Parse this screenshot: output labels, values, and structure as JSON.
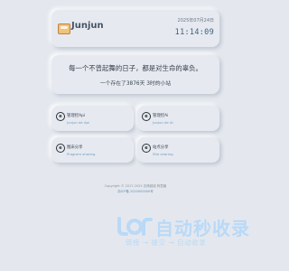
{
  "header": {
    "site_name": "Junjun",
    "date": "2025年07月24日",
    "time": "11:14:09"
  },
  "quote": {
    "motto": "每一个不曾起舞的日子，都是对生命的辜负。",
    "since": "一个存在了3876天 3时的小站"
  },
  "cards": [
    {
      "title": "管理控Api",
      "subtitle": "Junjun de Api",
      "icon": "circle-e-icon"
    },
    {
      "title": "管理控Ai",
      "subtitle": "Junjun de Ai",
      "icon": "circle-e-icon"
    },
    {
      "title": "图床分享",
      "subtitle": "Program sharing",
      "icon": "circle-e-icon"
    },
    {
      "title": "站点分享",
      "subtitle": "Site sharing",
      "icon": "circle-e-icon"
    }
  ],
  "footer": {
    "copyright": "Copyright © 2017-2025 友情链接 阿里酱",
    "beian": "浙ICP备 2020000000号"
  },
  "watermark": {
    "title": "自动秒收录",
    "subtitle": "链接 → 提交 → 自动收录"
  },
  "colors": {
    "background": "#e4e8ee",
    "card_surface": "#e6eaf0",
    "clock": "#3d6078",
    "card_subtitle": "#6e9ac0",
    "watermark": "#b9d9f7"
  }
}
